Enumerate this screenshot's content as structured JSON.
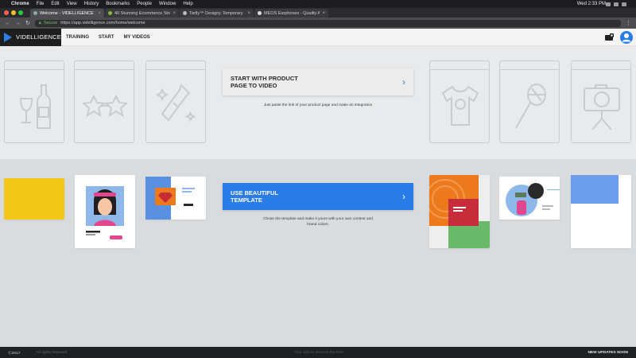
{
  "menubar": {
    "app": "Chrome",
    "menus": [
      "File",
      "Edit",
      "View",
      "History",
      "Bookmarks",
      "People",
      "Window",
      "Help"
    ],
    "clock": "Wed 2:33 PM"
  },
  "tabs": [
    {
      "title": "Welcome - VIDELLIGENCE",
      "active": true
    },
    {
      "title": "40 Stunning Ecommerce Sto",
      "active": false
    },
    {
      "title": "Tartly™ Designy Temporary",
      "active": false
    },
    {
      "title": "MEOS Earphones - Quality A",
      "active": false
    }
  ],
  "address": {
    "secure_label": "Secure",
    "url": "https://app.videlligence.com/home/welcome"
  },
  "app": {
    "brand": "VIDELLIGENCE",
    "nav": [
      "TRAINING",
      "START",
      "MY VIDEOS"
    ]
  },
  "cta_product": {
    "label": "START WITH PRODUCT\nPAGE TO VIDEO",
    "desc": "Just paste the link of your product page and make an integration"
  },
  "cta_template": {
    "label": "USE BEAUTIFUL\nTEMPLATE",
    "desc": "Chose the template and make it yours with your own content and brand colors."
  },
  "footer": {
    "copyright": "Ⓒ2017",
    "muted_left": "All rights reserved",
    "center": "Your videos deserve the best",
    "updates": "NEW UPDATES SOON"
  },
  "colors": {
    "accent_blue": "#2a7ce6",
    "yellow": "#f2c718",
    "orange": "#ec7a1c",
    "red": "#c62c3a",
    "green": "#6ab96a",
    "pink": "#e0478f"
  }
}
